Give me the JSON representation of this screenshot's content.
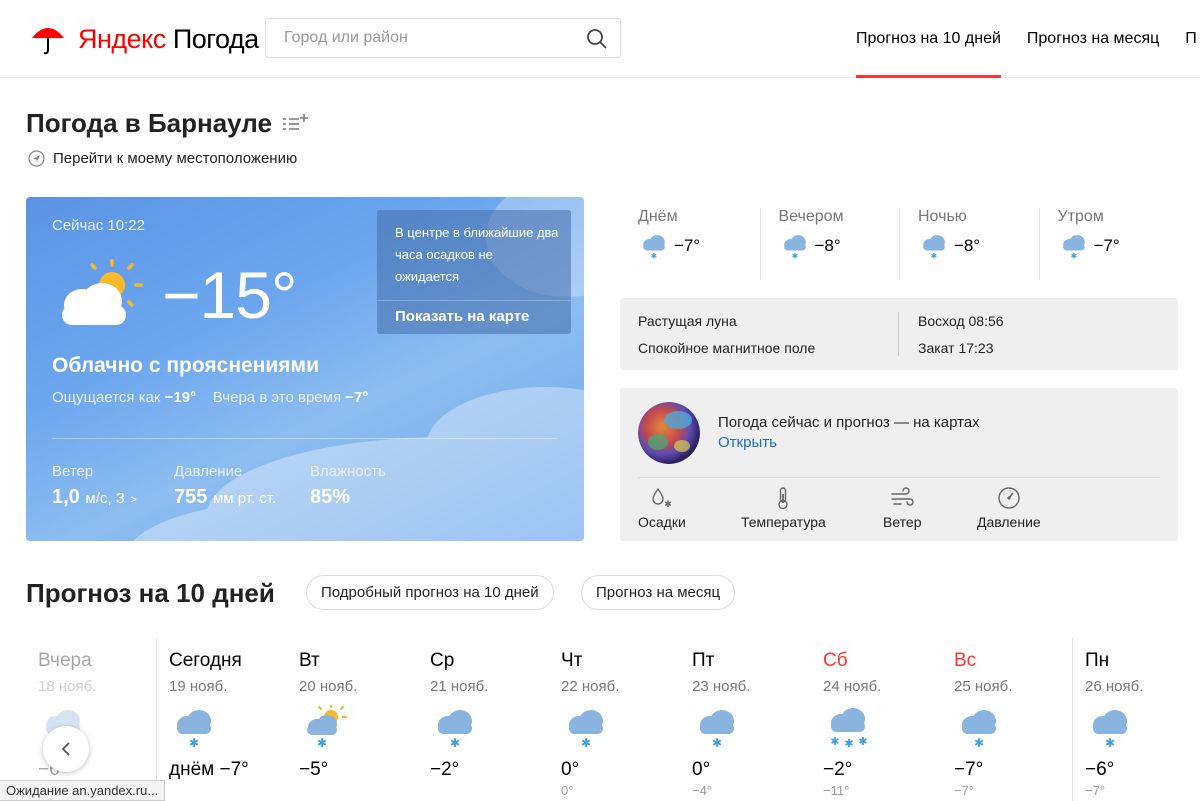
{
  "header": {
    "logo_brand": "Яндекс",
    "logo_product": "Погода",
    "search_placeholder": "Город или район",
    "nav": [
      "Прогноз на 10 дней",
      "Прогноз на месяц",
      "П"
    ]
  },
  "page": {
    "title": "Погода в Барнауле",
    "geo_link": "Перейти к моему местоположению"
  },
  "now": {
    "time_label": "Сейчас 10:22",
    "temp": "−15°",
    "condition": "Облачно с прояснениями",
    "feels_label": "Ощущается как",
    "feels_value": "−19°",
    "yesterday_label": "Вчера в это время",
    "yesterday_value": "−7°",
    "precip_text": "В центре в ближайшие два часа осадков не ожидается",
    "precip_link": "Показать на карте",
    "wind_label": "Ветер",
    "wind_value": "1,0",
    "wind_unit": "м/с, З",
    "pressure_label": "Давление",
    "pressure_value": "755",
    "pressure_unit": "мм рт. ст.",
    "humidity_label": "Влажность",
    "humidity_value": "85%"
  },
  "parts_of_day": [
    {
      "name": "Днём",
      "temp": "−7°"
    },
    {
      "name": "Вечером",
      "temp": "−8°"
    },
    {
      "name": "Ночью",
      "temp": "−8°"
    },
    {
      "name": "Утром",
      "temp": "−7°"
    }
  ],
  "astro": {
    "moon": "Растущая луна",
    "magnetic": "Спокойное магнитное поле",
    "sunrise": "Восход 08:56",
    "sunset": "Закат 17:23"
  },
  "maps": {
    "title": "Погода сейчас и прогноз — на картах",
    "open_link": "Открыть",
    "links": [
      "Осадки",
      "Температура",
      "Ветер",
      "Давление"
    ]
  },
  "forecast": {
    "title": "Прогноз на 10 дней",
    "btn_detailed": "Подробный прогноз на 10 дней",
    "btn_month": "Прогноз на месяц",
    "days": [
      {
        "name": "Вчера",
        "date": "18 нояб.",
        "day": "−6°",
        "night": "",
        "icon": "cloud-snow-icon"
      },
      {
        "name": "Сегодня",
        "date": "19 нояб.",
        "day": "днём −7°",
        "night": "",
        "icon": "cloud-snow-icon"
      },
      {
        "name": "Вт",
        "date": "20 нояб.",
        "day": "−5°",
        "night": "",
        "icon": "partly-cloudy-snow-icon"
      },
      {
        "name": "Ср",
        "date": "21 нояб.",
        "day": "−2°",
        "night": "",
        "icon": "cloud-snow-icon"
      },
      {
        "name": "Чт",
        "date": "22 нояб.",
        "day": "0°",
        "night": "0°",
        "icon": "cloud-snow-icon"
      },
      {
        "name": "Пт",
        "date": "23 нояб.",
        "day": "0°",
        "night": "−4°",
        "icon": "cloud-snow-icon"
      },
      {
        "name": "Сб",
        "date": "24 нояб.",
        "day": "−2°",
        "night": "−11°",
        "icon": "cloud-heavy-snow-icon"
      },
      {
        "name": "Вс",
        "date": "25 нояб.",
        "day": "−7°",
        "night": "−7°",
        "icon": "cloud-snow-icon"
      },
      {
        "name": "Пн",
        "date": "26 нояб.",
        "day": "−6°",
        "night": "−7°",
        "icon": "cloud-snow-icon"
      }
    ]
  },
  "status_bar": "Ожидание an.yandex.ru...",
  "colors": {
    "accent_red": "#ff3333",
    "link_blue": "#1a6fc8",
    "card_blue": "#6aa4ee"
  }
}
